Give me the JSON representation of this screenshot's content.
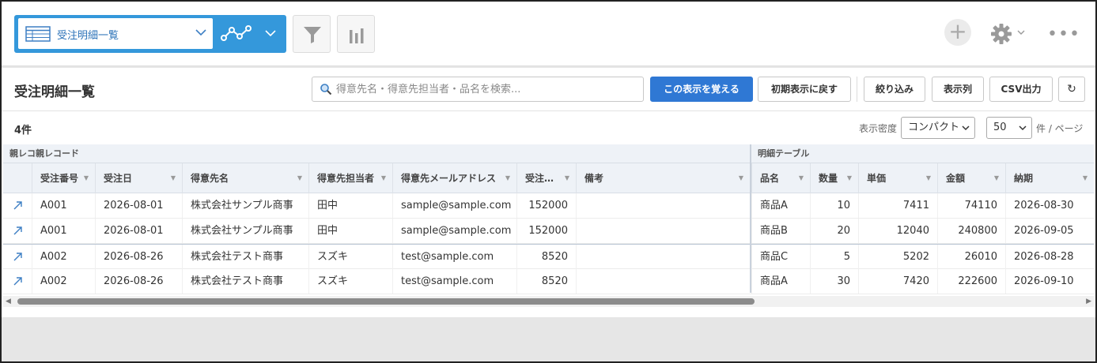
{
  "toolbar": {
    "view_name": "受注明細一覧",
    "more_label": "•••"
  },
  "panel": {
    "title": "受注明細一覧",
    "search_placeholder": "得意先名・得意先担当者・品名を検索...",
    "save_view_label": "この表示を覚える",
    "reset_view_label": "初期表示に戻す",
    "filter_label": "絞り込み",
    "columns_label": "表示列",
    "csv_label": "CSV出力",
    "refresh_label": "↻",
    "count_label": "4件",
    "density_label": "表示密度",
    "density_value": "コンパクト",
    "page_size_value": "50",
    "per_page_label": "件 / ページ"
  },
  "grid": {
    "group_parent": "親レコ​親レコード",
    "group_detail": "明細テーブル",
    "columns": [
      "受注番号",
      "受注日",
      "得意先名",
      "得意先担当者",
      "得意先メールアドレス",
      "受注…",
      "備考",
      "品名",
      "数量",
      "単価",
      "金額",
      "納期"
    ],
    "rows": [
      {
        "order_no": "A001",
        "order_date": "2026-08-01",
        "customer": "株式会社サンプル商事",
        "contact": "田中",
        "email": "sample@sample.com",
        "amount": "152000",
        "note": "",
        "item": "商品A",
        "qty": "10",
        "unit_price": "7411",
        "total": "74110",
        "due": "2026-08-30"
      },
      {
        "order_no": "A001",
        "order_date": "2026-08-01",
        "customer": "株式会社サンプル商事",
        "contact": "田中",
        "email": "sample@sample.com",
        "amount": "152000",
        "note": "",
        "item": "商品B",
        "qty": "20",
        "unit_price": "12040",
        "total": "240800",
        "due": "2026-09-05"
      },
      {
        "order_no": "A002",
        "order_date": "2026-08-26",
        "customer": "株式会社テスト商事",
        "contact": "スズキ",
        "email": "test@sample.com",
        "amount": "8520",
        "note": "",
        "item": "商品C",
        "qty": "5",
        "unit_price": "5202",
        "total": "26010",
        "due": "2026-08-28"
      },
      {
        "order_no": "A002",
        "order_date": "2026-08-26",
        "customer": "株式会社テスト商事",
        "contact": "スズキ",
        "email": "test@sample.com",
        "amount": "8520",
        "note": "",
        "item": "商品A",
        "qty": "30",
        "unit_price": "7420",
        "total": "222600",
        "due": "2026-09-10"
      }
    ]
  },
  "colors": {
    "accent": "#3498db",
    "primary_button": "#2f78d4",
    "link": "#2b72b8"
  }
}
